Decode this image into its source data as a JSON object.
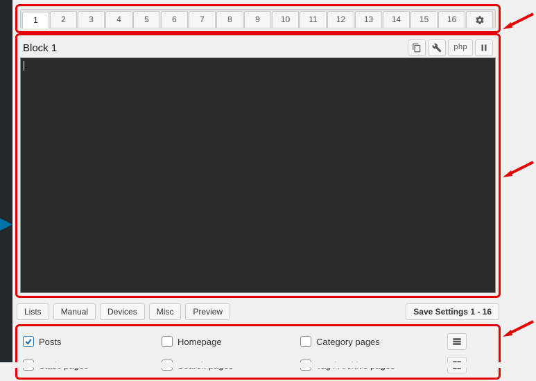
{
  "tabs": {
    "items": [
      "1",
      "2",
      "3",
      "4",
      "5",
      "6",
      "7",
      "8",
      "9",
      "10",
      "11",
      "12",
      "13",
      "14",
      "15",
      "16"
    ],
    "active": "1",
    "gear_name": "settings-icon"
  },
  "block": {
    "title": "Block 1",
    "tools": {
      "copy": "copy-icon",
      "wrench": "wrench-icon",
      "php_label": "php",
      "pause": "pause-icon"
    }
  },
  "actions": {
    "buttons": [
      "Lists",
      "Manual",
      "Devices",
      "Misc",
      "Preview"
    ],
    "save_label": "Save Settings 1 - 16"
  },
  "checks": {
    "row1": [
      {
        "label": "Posts",
        "checked": true
      },
      {
        "label": "Homepage",
        "checked": false
      },
      {
        "label": "Category pages",
        "checked": false
      }
    ],
    "row2": [
      {
        "label": "Static pages",
        "checked": false
      },
      {
        "label": "Search pages",
        "checked": false
      },
      {
        "label": "Tag / Archive pages",
        "checked": false
      }
    ],
    "side_icons": {
      "list": "list-icon",
      "grid": "grid-icon"
    }
  },
  "annotations": {
    "arrow_color": "#e60000"
  }
}
